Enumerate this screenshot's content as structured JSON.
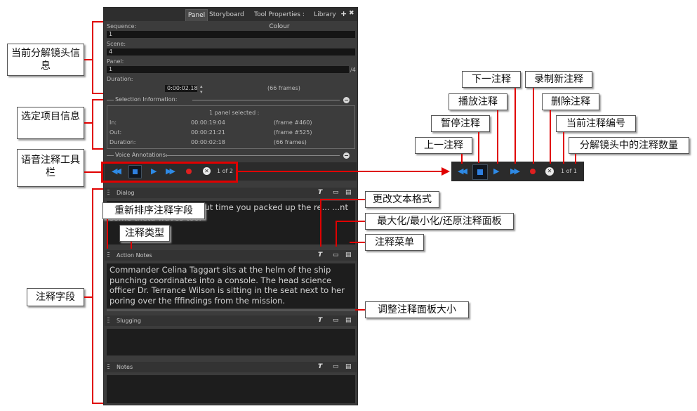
{
  "tabs": [
    "Panel",
    "Storyboard",
    "Tool Properties : Colour",
    "Library"
  ],
  "tab_icons": {
    "add": "+",
    "close": "✖"
  },
  "fields": {
    "sequence_label": "Sequence:",
    "sequence_value": "1",
    "scene_label": "Scene:",
    "scene_value": "4",
    "panel_label": "Panel:",
    "panel_value": "1",
    "panel_total": "/4",
    "duration_label": "Duration:",
    "duration_value": "0:00:02.18",
    "duration_frames": "(66 frames)"
  },
  "selection": {
    "header": "Selection Information:",
    "summary": "1 panel selected :",
    "rows": [
      {
        "label": "In:",
        "time": "00:00:19:04",
        "frame": "(frame #460)"
      },
      {
        "label": "Out:",
        "time": "00:00:21:21",
        "frame": "(frame #525)"
      },
      {
        "label": "Duration:",
        "time": "00:00:02:18",
        "frame": "(66 frames)"
      }
    ]
  },
  "voice": {
    "header": "Voice Annotations:",
    "counter": "1 of 2",
    "zoom_counter": "1 of 1",
    "icons": [
      "previous-icon",
      "pause-icon",
      "play-icon",
      "next-icon",
      "record-icon",
      "delete-icon"
    ]
  },
  "notes": [
    {
      "title": "Dialog",
      "text": "Al... ...'s zipped up. About time you packed up the re... ...nt some theta waves too."
    },
    {
      "title": "Action Notes",
      "text": "Commander Celina Taggart sits at the helm of the ship punching coordinates into a console. The head science officer Dr. Terrance Wilson is sitting in the seat next to her poring over the fffindings from the mission."
    },
    {
      "title": "Slugging",
      "text": ""
    },
    {
      "title": "Notes",
      "text": ""
    }
  ],
  "callouts": {
    "current_panel_info": "当前分解镜头信息",
    "selection_info": "选定项目信息",
    "voice_toolbar": "语音注释工具栏",
    "note_fields": "注释字段",
    "reorder": "重新排序注释字段",
    "note_type": "注释类型",
    "text_format": "更改文本格式",
    "maximize": "最大化/最小化/还原注释面板",
    "note_menu": "注释菜单",
    "resize": "调整注释面板大小",
    "previous": "上一注释",
    "pause": "暂停注释",
    "play": "播放注释",
    "next": "下一注释",
    "record": "录制新注释",
    "delete": "删除注释",
    "current_number": "当前注释编号",
    "count": "分解镜头中的注释数量"
  },
  "colors": {
    "accent_red": "#e00000",
    "panel_bg": "#3c3c3c",
    "play_blue": "#2e8ae6",
    "record_red": "#e02020"
  }
}
